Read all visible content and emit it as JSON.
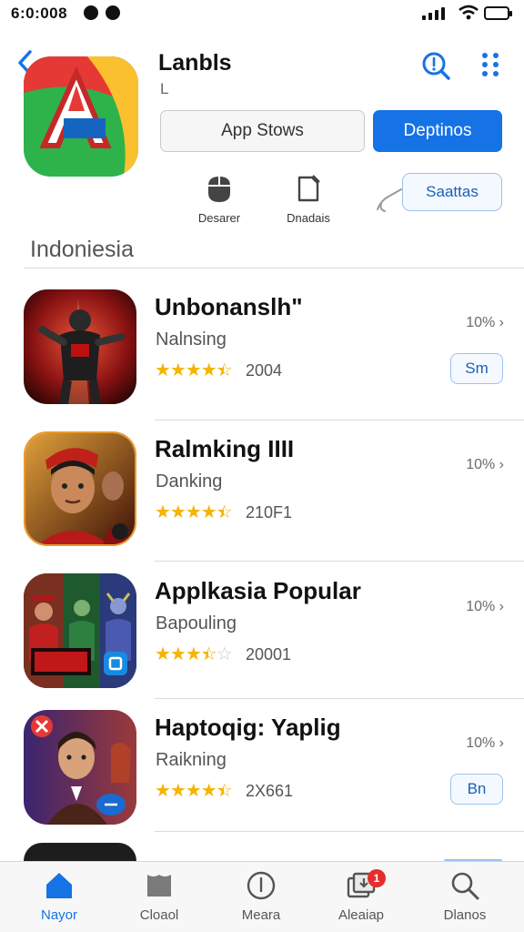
{
  "status_bar": {
    "time": "6:0:008"
  },
  "header": {
    "title": "Lanbls",
    "subtitle": "L",
    "app_stores_button": "App Stows",
    "options_button": "Deptinos",
    "actions": [
      {
        "label": "Desarer",
        "icon": "mouse-icon"
      },
      {
        "label": "Dnadais",
        "icon": "edit-icon"
      }
    ],
    "save_button": "Saattas",
    "accent_color": "#1673e6"
  },
  "section": {
    "title": "Indoniesia"
  },
  "apps": [
    {
      "name": "Unbonanslh\"",
      "subtitle": "Nalnsing",
      "rating": 4.5,
      "rating_count": "2004",
      "percent": "10%",
      "button": "Sm",
      "thumb_colors": [
        "#b01818",
        "#2a0606"
      ]
    },
    {
      "name": "Ralmking IIII",
      "subtitle": "Danking",
      "rating": 4.5,
      "rating_count": "210F1",
      "percent": "10%",
      "thumb_colors": [
        "#c8561e",
        "#3a1208"
      ]
    },
    {
      "name": "Applkasia Popular",
      "subtitle": "Bapouling",
      "rating": 3.5,
      "rating_count": "20001",
      "percent": "10%",
      "thumb_colors": [
        "#2a6f2a",
        "#1c2350"
      ]
    },
    {
      "name": "Haptoqig: Yaplig",
      "subtitle": "Raikning",
      "rating": 4.5,
      "rating_count": "2X661",
      "percent": "10%",
      "button": "Bn",
      "thumb_colors": [
        "#4a2a7a",
        "#a03a2a"
      ]
    }
  ],
  "tabs": [
    {
      "label": "Nayor",
      "icon": "home-icon",
      "active": true
    },
    {
      "label": "Cloaol",
      "icon": "cloud-icon",
      "active": false
    },
    {
      "label": "Meara",
      "icon": "info-icon",
      "active": false
    },
    {
      "label": "Aleaiap",
      "icon": "updates-icon",
      "active": false,
      "badge": "1"
    },
    {
      "label": "Dlanos",
      "icon": "search-icon",
      "active": false
    }
  ]
}
